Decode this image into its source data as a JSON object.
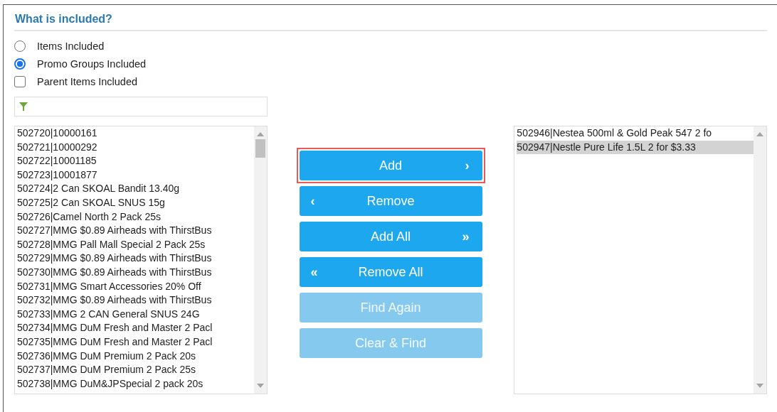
{
  "section": {
    "title": "What is included?"
  },
  "options": [
    {
      "kind": "radio",
      "label": "Items Included",
      "selected": false
    },
    {
      "kind": "radio",
      "label": "Promo Groups Included",
      "selected": true
    },
    {
      "kind": "checkbox",
      "label": "Parent Items Included",
      "checked": false
    }
  ],
  "available_list": {
    "items": [
      {
        "text": "502720|10000161",
        "selected": false
      },
      {
        "text": "502721|10000292",
        "selected": false
      },
      {
        "text": "502722|10001185",
        "selected": false
      },
      {
        "text": "502723|10001877",
        "selected": false
      },
      {
        "text": "502724|2 Can SKOAL Bandit 13.40g",
        "selected": false
      },
      {
        "text": "502725|2 Can SKOAL SNUS 15g",
        "selected": false
      },
      {
        "text": "502726|Camel North 2 Pack 25s",
        "selected": false
      },
      {
        "text": "502727|MMG $0.89 Airheads with ThirstBus",
        "selected": false
      },
      {
        "text": "502728|MMG Pall Mall Special 2 Pack 25s",
        "selected": false
      },
      {
        "text": "502729|MMG $0.89 Airheads with ThirstBus",
        "selected": false
      },
      {
        "text": "502730|MMG $0.89 Airheads with ThirstBus",
        "selected": false
      },
      {
        "text": "502731|MMG Smart Accessories 20% Off",
        "selected": false
      },
      {
        "text": "502732|MMG $0.89 Airheads with ThirstBus",
        "selected": false
      },
      {
        "text": "502733|MMG 2 CAN General SNUS 24G",
        "selected": false
      },
      {
        "text": "502734|MMG DuM Fresh and Master 2 Pacl",
        "selected": false
      },
      {
        "text": "502735|MMG DuM Fresh and Master 2 Pacl",
        "selected": false
      },
      {
        "text": "502736|MMG DuM Premium 2 Pack 20s",
        "selected": false
      },
      {
        "text": "502737|MMG DuM Premium 2 Pack 25s",
        "selected": false
      },
      {
        "text": "502738|MMG DuM&JPSpecial 2 pack 20s",
        "selected": false
      }
    ]
  },
  "buttons": [
    {
      "label": "Add",
      "icon_right": "›",
      "disabled": false,
      "highlighted": true
    },
    {
      "label": "Remove",
      "icon_left": "‹",
      "disabled": false,
      "highlighted": false
    },
    {
      "label": "Add All",
      "icon_right": "»",
      "disabled": false,
      "highlighted": false
    },
    {
      "label": "Remove All",
      "icon_left": "«",
      "disabled": false,
      "highlighted": false
    },
    {
      "label": "Find Again",
      "disabled": true,
      "highlighted": false
    },
    {
      "label": "Clear & Find",
      "disabled": true,
      "highlighted": false
    }
  ],
  "included_list": {
    "items": [
      {
        "text": "502946|Nestea 500ml & Gold Peak 547 2 fo",
        "selected": false
      },
      {
        "text": "502947|Nestle Pure Life 1.5L 2 for $3.33",
        "selected": true
      }
    ]
  }
}
